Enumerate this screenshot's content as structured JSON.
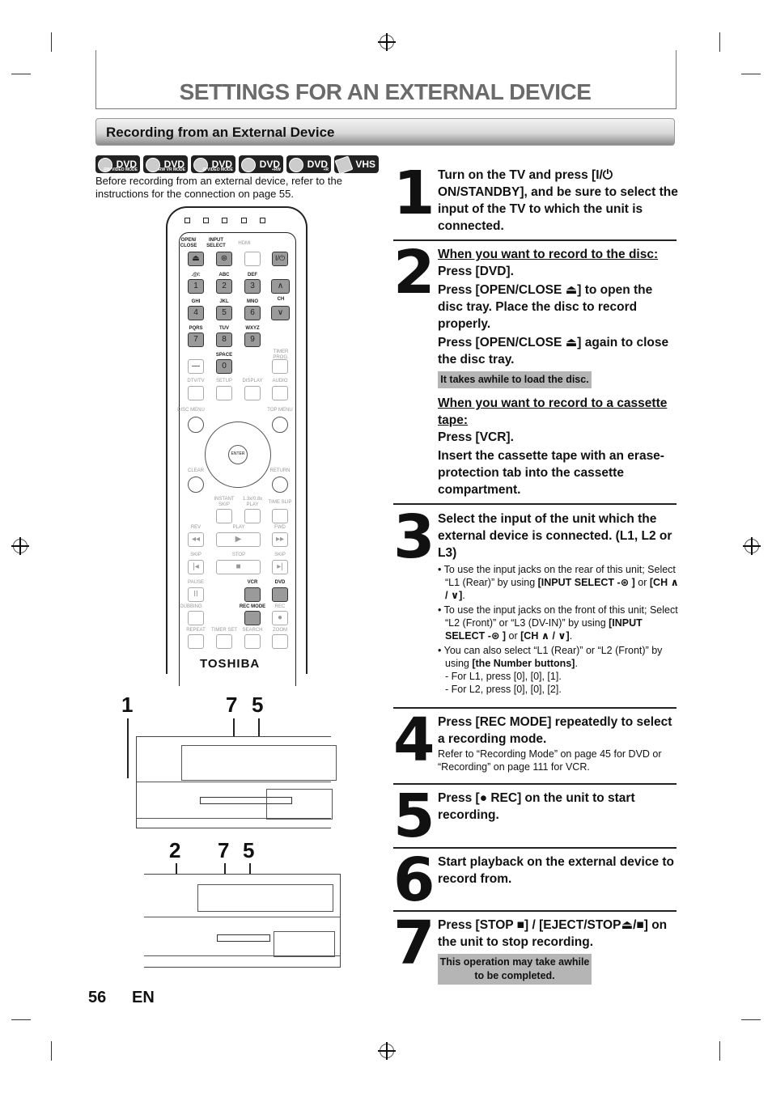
{
  "page": {
    "title": "SETTINGS FOR AN EXTERNAL DEVICE",
    "section_title": "Recording from an External Device",
    "page_number": "56",
    "language": "EN"
  },
  "media_badges": [
    {
      "label": "DVD",
      "sub": "-RW VIDEO MODE",
      "icon": "disc-icon"
    },
    {
      "label": "DVD",
      "sub": "-RW VR MODE",
      "icon": "disc-icon"
    },
    {
      "label": "DVD",
      "sub": "-R VIDEO MODE",
      "icon": "disc-icon"
    },
    {
      "label": "DVD",
      "sub": "+RW",
      "icon": "disc-icon"
    },
    {
      "label": "DVD",
      "sub": "+R",
      "icon": "disc-icon"
    },
    {
      "label": "VHS",
      "sub": "",
      "icon": "cassette-icon"
    }
  ],
  "intro_text": "Before recording from an external device, refer to the instructions for the connection on page 55.",
  "remote": {
    "brand": "TOSHIBA",
    "labels": {
      "open_close": "OPEN/ CLOSE",
      "input_select": "INPUT SELECT",
      "hdmi": "HDMI",
      "power": "I/⏻",
      "k1": ".@/:",
      "k2": "ABC",
      "k3": "DEF",
      "k4": "GHI",
      "k5": "JKL",
      "k6": "MNO",
      "k7": "PQRS",
      "k8": "TUV",
      "k9": "WXYZ",
      "k0": "SPACE",
      "ch": "CH",
      "timer_prog": "TIMER PROG.",
      "dtv_tv": "DTV/TV",
      "setup": "SETUP",
      "display": "DISPLAY",
      "audio": "AUDIO",
      "disc_menu": "DISC MENU",
      "top_menu": "TOP MENU",
      "enter": "ENTER",
      "clear": "CLEAR",
      "return": "RETURN",
      "instant_skip": "INSTANT SKIP",
      "speed_play": "1.3x/0.8x PLAY",
      "time_slip": "TIME SLIP",
      "rev": "REV",
      "play": "PLAY",
      "fwd": "FWD",
      "skip_back": "SKIP",
      "stop": "STOP",
      "skip_fwd": "SKIP",
      "pause": "PAUSE",
      "vcr": "VCR",
      "dvd": "DVD",
      "dubbing": "DUBBING",
      "rec_mode": "REC MODE",
      "rec": "REC",
      "repeat": "REPEAT",
      "timer_set": "TIMER SET",
      "search": "SEARCH",
      "zoom": "ZOOM"
    },
    "digits": [
      "1",
      "2",
      "3",
      "4",
      "5",
      "6",
      "7",
      "8",
      "9",
      "0",
      "—"
    ]
  },
  "diagram_callouts": {
    "top": [
      "1",
      "7",
      "5"
    ],
    "bottom": [
      "2",
      "7",
      "5"
    ]
  },
  "steps": [
    {
      "num": "1",
      "lines": [
        "Turn on the TV and press [I/⏻ ON/STANDBY], and be sure to select the input of the TV to which the unit is connected."
      ]
    },
    {
      "num": "2",
      "disc_heading": "When you want to record to the disc:",
      "disc_press": "Press [DVD].",
      "disc_open": "Press [OPEN/CLOSE ⏏] to open the disc tray. Place the disc to record properly.",
      "disc_close": "Press [OPEN/CLOSE ⏏] again to close the disc tray.",
      "disc_note": "It takes awhile to load the disc.",
      "tape_heading": "When you want to record to a cassette tape:",
      "tape_press": "Press [VCR].",
      "tape_insert": "Insert the cassette tape with an erase-protection tab into the cassette compartment."
    },
    {
      "num": "3",
      "heading": "Select the input of the unit which the external device is connected. (L1, L2 or L3)",
      "bullets": [
        {
          "text": "To use the input jacks on the rear of this unit; Select “L1 (Rear)” by using ",
          "bold": "[INPUT SELECT -⊛ ]",
          "tail": " or ",
          "bold2": "[CH ∧ / ∨]",
          "end": "."
        },
        {
          "text": "To use the input jacks on the front of this unit; Select “L2 (Front)” or “L3 (DV-IN)” by using ",
          "bold": "[INPUT SELECT -⊛ ]",
          "tail": " or ",
          "bold2": "[CH ∧ / ∨]",
          "end": "."
        },
        {
          "text": "You can also select “L1 (Rear)” or “L2 (Front)” by using ",
          "bold": "[the Number buttons]",
          "tail": ".",
          "bold2": "",
          "end": ""
        }
      ],
      "sub_items": [
        "- For L1, press [0], [0], [1].",
        "- For L2, press [0], [0], [2]."
      ]
    },
    {
      "num": "4",
      "heading": "Press [REC MODE] repeatedly to select a recording mode.",
      "detail": "Refer to “Recording Mode” on page 45 for DVD or “Recording” on page 111 for VCR."
    },
    {
      "num": "5",
      "heading": "Press [● REC] on the unit to start recording."
    },
    {
      "num": "6",
      "heading": "Start playback on the external device to record from."
    },
    {
      "num": "7",
      "heading": "Press [STOP ■] / [EJECT/STOP⏏/■] on the unit to stop recording.",
      "note": "This operation may take awhile to be completed."
    }
  ]
}
